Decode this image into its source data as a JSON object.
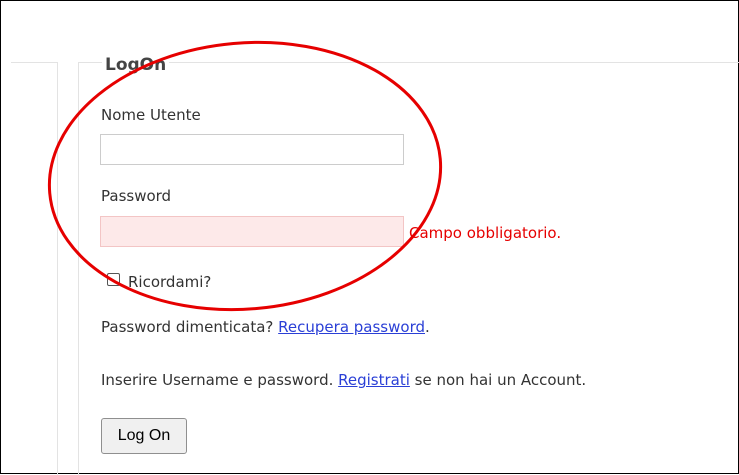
{
  "form": {
    "legend": "LogOn",
    "username_label": "Nome Utente",
    "username_value": "",
    "password_label": "Password",
    "password_value": "",
    "password_error": "Campo obbligatorio.",
    "remember_label": "Ricordami?",
    "forgot_text": "Password dimenticata? ",
    "forgot_link": "Recupera password",
    "forgot_suffix": ".",
    "register_prefix": "Inserire Username e password. ",
    "register_link": "Registrati",
    "register_suffix": " se non hai un Account.",
    "submit_label": "Log On"
  },
  "colors": {
    "error": "#e60000",
    "invalid_field_bg": "#fde9e9",
    "link": "#2a3fd6",
    "annotation": "#e60000"
  }
}
